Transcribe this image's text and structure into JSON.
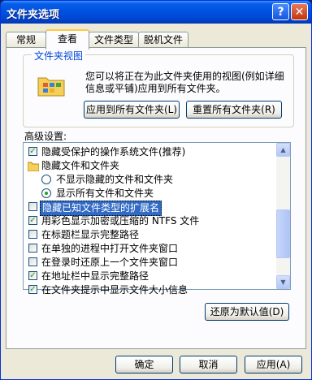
{
  "window": {
    "title": "文件夹选项"
  },
  "titlebar_buttons": {
    "help": "?",
    "close": "✕"
  },
  "tabs": [
    {
      "label": "常规"
    },
    {
      "label": "查看"
    },
    {
      "label": "文件类型"
    },
    {
      "label": "脱机文件"
    }
  ],
  "folder_views": {
    "legend": "文件夹视图",
    "description": "您可以将正在为此文件夹使用的视图(例如详细信息或平铺)应用到所有文件夹。",
    "apply_all_label": "应用到所有文件夹(L)",
    "reset_all_label": "重置所有文件夹(R)"
  },
  "advanced": {
    "label": "高级设置:",
    "items": [
      {
        "type": "checkbox",
        "checked": true,
        "label": "隐藏受保护的操作系统文件(推荐)"
      },
      {
        "type": "folder",
        "label": "隐藏文件和文件夹"
      },
      {
        "type": "radio",
        "checked": false,
        "label": "不显示隐藏的文件和文件夹"
      },
      {
        "type": "radio",
        "checked": true,
        "label": "显示所有文件和文件夹"
      },
      {
        "type": "checkbox",
        "checked": false,
        "label": "隐藏已知文件类型的扩展名",
        "selected": true
      },
      {
        "type": "checkbox",
        "checked": true,
        "label": "用彩色显示加密或压缩的 NTFS 文件"
      },
      {
        "type": "checkbox",
        "checked": false,
        "label": "在标题栏显示完整路径"
      },
      {
        "type": "checkbox",
        "checked": false,
        "label": "在单独的进程中打开文件夹窗口"
      },
      {
        "type": "checkbox",
        "checked": false,
        "label": "在登录时还原上一个文件夹窗口"
      },
      {
        "type": "checkbox",
        "checked": true,
        "label": "在地址栏中显示完整路径"
      },
      {
        "type": "checkbox",
        "checked": true,
        "label": "在文件夹提示中显示文件大小信息"
      }
    ],
    "restore_defaults_label": "还原为默认值(D)"
  },
  "footer": {
    "ok": "确定",
    "cancel": "取消",
    "apply": "应用(A)"
  },
  "colors": {
    "titlebar": "#0054e3",
    "selection": "#316ac5",
    "dialog_bg": "#ece9d8"
  }
}
